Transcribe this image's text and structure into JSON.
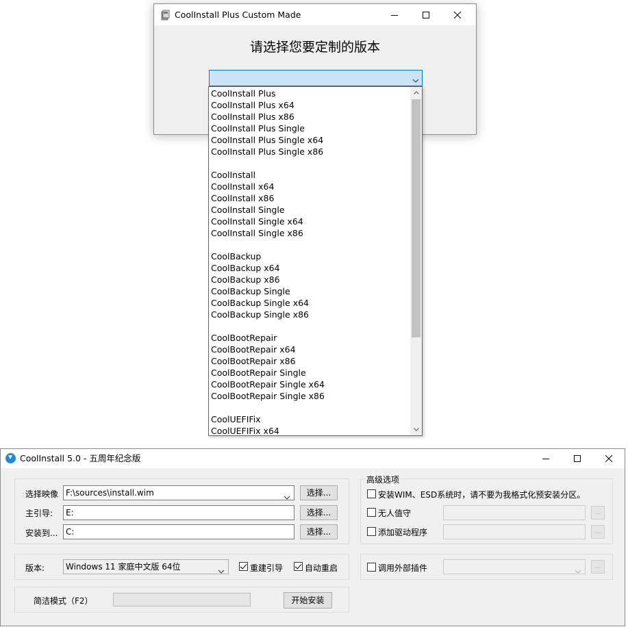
{
  "custom_window": {
    "title": "CoolInstall Plus Custom Made",
    "heading": "请选择您要定制的版本",
    "options": [
      "CoolInstall Plus",
      "CoolInstall Plus x64",
      "CoolInstall Plus x86",
      "CoolInstall Plus Single",
      "CoolInstall Plus Single x64",
      "CoolInstall Plus Single x86",
      "",
      "CoolInstall",
      "CoolInstall x64",
      "CoolInstall x86",
      "CoolInstall Single",
      "CoolInstall Single x64",
      "CoolInstall Single x86",
      "",
      "CoolBackup",
      "CoolBackup x64",
      "CoolBackup x86",
      "CoolBackup Single",
      "CoolBackup Single x64",
      "CoolBackup Single x86",
      "",
      "CoolBootRepair",
      "CoolBootRepair x64",
      "CoolBootRepair x86",
      "CoolBootRepair Single",
      "CoolBootRepair Single x64",
      "CoolBootRepair Single x86",
      "",
      "CoolUEFIFix",
      "CoolUEFIFix x64"
    ]
  },
  "main_window": {
    "title": "CoolInstall 5.0 - 五周年纪念版",
    "image_label": "选择映像",
    "image_value": "F:\\sources\\install.wim",
    "boot_label": "主引导:",
    "boot_value": "E:",
    "install_label": "安装到...",
    "install_value": "C:",
    "browse_label": "选择...",
    "edition_label": "版本:",
    "edition_value": "Windows 11 家庭中文版  64位",
    "rebuild_boot_label": "重建引导",
    "rebuild_boot_checked": true,
    "auto_restart_label": "自动重启",
    "auto_restart_checked": true,
    "simple_mode_label": "简洁模式（F2）",
    "progress": 0,
    "start_label": "开始安装",
    "advanced_title": "高级选项",
    "esd_option_label": "安装WIM、ESD系统时，请不要为我格式化预安装分区。",
    "esd_option_checked": false,
    "unattended_label": "无人值守",
    "unattended_checked": false,
    "add_driver_label": "添加驱动程序",
    "add_driver_checked": false,
    "ellipsis_label": "...",
    "plugin_label": "调用外部插件",
    "plugin_checked": false
  }
}
